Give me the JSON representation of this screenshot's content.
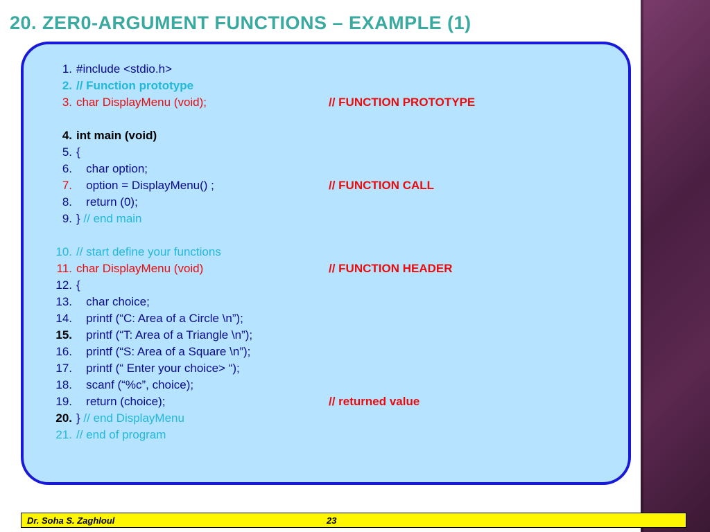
{
  "title_num": "20.",
  "title_rest": " ZER0-ARGUMENT FUNCTIONS  – EXAMPLE (1)",
  "lines": {
    "l1": "#include <stdio.h>",
    "l2": "// Function prototype",
    "l3": "char DisplayMenu (void);",
    "l3c": "// FUNCTION PROTOTYPE",
    "l4": "int main (void)",
    "l5": "{",
    "l6": "   char option;",
    "l7": "   option = DisplayMenu() ;",
    "l7c": "// FUNCTION CALL",
    "l8": "   return (0);",
    "l9a": "} ",
    "l9b": "// end main",
    "l10": "// start define your functions",
    "l11": "char DisplayMenu (void)",
    "l11c": "// FUNCTION HEADER",
    "l12": "{",
    "l13": "   char choice;",
    "l14": "   printf (“C: Area of a Circle \\n”);",
    "l15": "   printf (“T: Area of a Triangle \\n”);",
    "l16": "   printf (“S: Area of a Square \\n”);",
    "l17": "   printf (“ Enter your choice> “);",
    "l18": "   scanf (“%c”, choice);",
    "l19": "   return (choice);",
    "l19c": "// returned value",
    "l20a": "} ",
    "l20b": "// end DisplayMenu",
    "l21": "// end of program"
  },
  "footer": {
    "author": "Dr. Soha S. Zaghloul",
    "page": "23"
  }
}
